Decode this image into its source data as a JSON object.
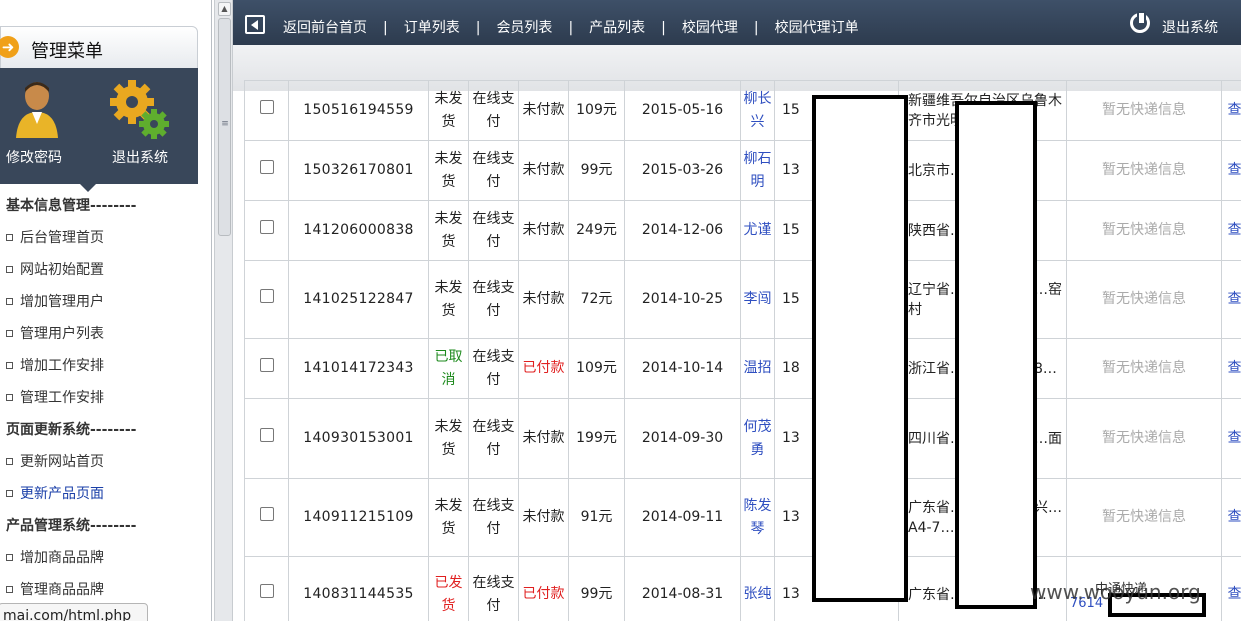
{
  "sidebar": {
    "title": "管理菜单",
    "change_password": "修改密码",
    "logout": "退出系统",
    "sections": [
      {
        "title": "基本信息管理--------",
        "items": [
          "后台管理首页",
          "网站初始配置",
          "增加管理用户",
          "管理用户列表",
          "增加工作安排",
          "管理工作安排"
        ]
      },
      {
        "title": "页面更新系统--------",
        "items": [
          "更新网站首页",
          "更新产品页面"
        ]
      },
      {
        "title": "产品管理系统--------",
        "items": [
          "增加商品品牌",
          "管理商品品牌"
        ]
      }
    ],
    "status_url": "mai.com/html.php"
  },
  "topnav": {
    "links": [
      "返回前台首页",
      "订单列表",
      "会员列表",
      "产品列表",
      "校园代理",
      "校园代理订单"
    ],
    "separator": "|",
    "logout": "退出系统"
  },
  "orders": [
    {
      "no": "150516194559",
      "status": "未发货",
      "pay": "在线支付",
      "paid": "未付款",
      "price": "109元",
      "date": "2015-05-16",
      "name": "柳长兴",
      "phone": "15",
      "addr": "新疆维吾尔自治区乌鲁木齐市光明路…杨",
      "ship": "暂无快递信息",
      "view": "查看"
    },
    {
      "no": "150326170801",
      "status": "未发货",
      "pay": "在线支付",
      "paid": "未付款",
      "price": "99元",
      "date": "2015-03-26",
      "name": "柳石明",
      "phone": "13",
      "addr": "北京市…区人民…",
      "ship": "暂无快递信息",
      "view": "查看"
    },
    {
      "no": "141206000838",
      "status": "未发货",
      "pay": "在线支付",
      "paid": "未付款",
      "price": "249元",
      "date": "2014-12-06",
      "name": "尤谨",
      "phone": "15",
      "addr": "陕西省…安大学…",
      "ship": "暂无快递信息",
      "view": "查看"
    },
    {
      "no": "141025122847",
      "status": "未发货",
      "pay": "在线支付",
      "paid": "未付款",
      "price": "72元",
      "date": "2014-10-25",
      "name": "李闯",
      "phone": "15",
      "addr": "辽宁省…港区…市龙…窑村",
      "ship": "暂无快递信息",
      "view": "查看"
    },
    {
      "no": "141014172343",
      "status": "已取消",
      "pay": "在线支付",
      "paid": "已付款",
      "price": "109元",
      "date": "2014-10-14",
      "name": "温招",
      "phone": "18",
      "addr": "浙江省…市北…荷路8…",
      "ship": "暂无快递信息",
      "view": "查看"
    },
    {
      "no": "140930153001",
      "status": "未发货",
      "pay": "在线支付",
      "paid": "未付款",
      "price": "199元",
      "date": "2014-09-30",
      "name": "何茂勇",
      "phone": "13",
      "addr": "四川省…区四…川县…面",
      "ship": "暂无快递信息",
      "view": "查看"
    },
    {
      "no": "140911215109",
      "status": "未发货",
      "pay": "在线支付",
      "paid": "未付款",
      "price": "91元",
      "date": "2014-09-11",
      "name": "陈发琴",
      "phone": "13",
      "addr": "广东省…区高新…科兴…A4-7…",
      "ship": "暂无快递信息",
      "view": "查看"
    },
    {
      "no": "140831144535",
      "status": "已发货",
      "pay": "在线支付",
      "paid": "已付款",
      "price": "99元",
      "date": "2014-08-31",
      "name": "张纯",
      "phone": "13",
      "addr": "广东省…市中…393…",
      "ship": "",
      "view": "查看"
    }
  ],
  "last_ship": {
    "carrier": "中通快递",
    "no": "7614"
  },
  "watermark": "www.wooyun.org",
  "colors": {
    "nav_bg": "#34455a",
    "link": "#2f4fc0",
    "red": "#e02020",
    "green": "#1d8a1d",
    "accent": "#f0a019"
  }
}
